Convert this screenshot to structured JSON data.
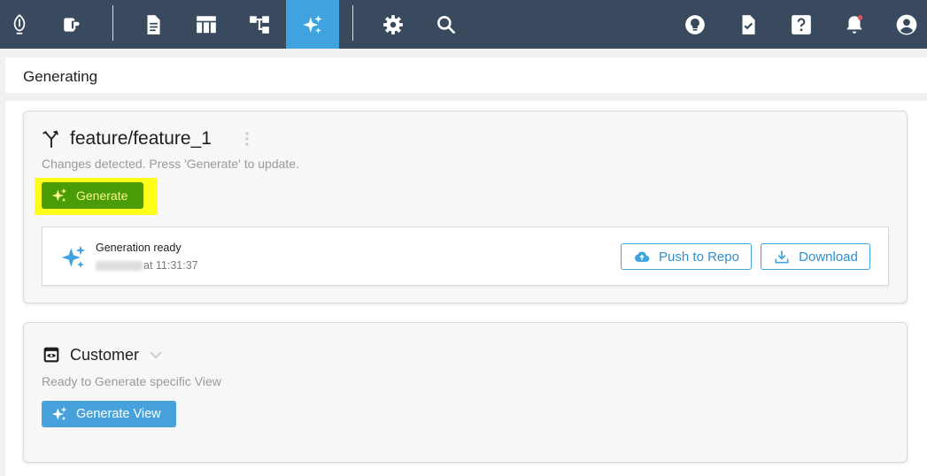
{
  "topbar": {
    "items": [
      {
        "icon": "app-logo-icon"
      },
      {
        "icon": "api-project-icon"
      },
      {
        "icon": "document-icon"
      },
      {
        "icon": "table-icon"
      },
      {
        "icon": "diagram-icon"
      },
      {
        "icon": "sparkles-icon",
        "active": true
      },
      {
        "icon": "gear-icon"
      },
      {
        "icon": "search-icon"
      },
      {
        "icon": "lightbulb-icon"
      },
      {
        "icon": "file-check-icon"
      },
      {
        "icon": "help-icon"
      },
      {
        "icon": "bell-icon",
        "badge": true
      },
      {
        "icon": "user-icon"
      }
    ]
  },
  "header": {
    "title": "Generating"
  },
  "branch_card": {
    "title": "feature/feature_1",
    "subtitle": "Changes detected. Press 'Generate' to update.",
    "generate_label": "Generate",
    "generation": {
      "status": "Generation ready",
      "time": "at 11:31:37",
      "push_label": "Push to Repo",
      "download_label": "Download"
    }
  },
  "view_card": {
    "title": "Customer",
    "subtitle": "Ready to Generate specific View",
    "button_label": "Generate View"
  },
  "colors": {
    "topbar": "#3a4a5e",
    "accent": "#3fa3df",
    "generate_button": "#4a9c08",
    "highlight": "#ffff1a"
  }
}
